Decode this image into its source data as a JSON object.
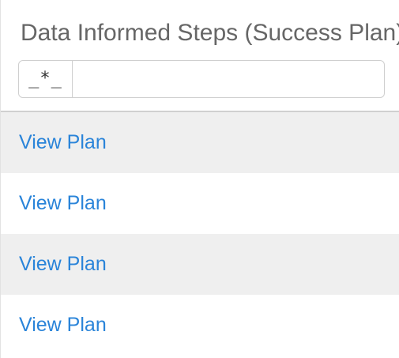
{
  "column": {
    "title": "Data Informed Steps (Success Plan)",
    "filter": {
      "mode_icon": "wildcard-icon",
      "mode_symbol": "_*_",
      "value": "",
      "placeholder": ""
    }
  },
  "rows": [
    {
      "link": "View Plan"
    },
    {
      "link": "View Plan"
    },
    {
      "link": "View Plan"
    },
    {
      "link": "View Plan"
    }
  ]
}
